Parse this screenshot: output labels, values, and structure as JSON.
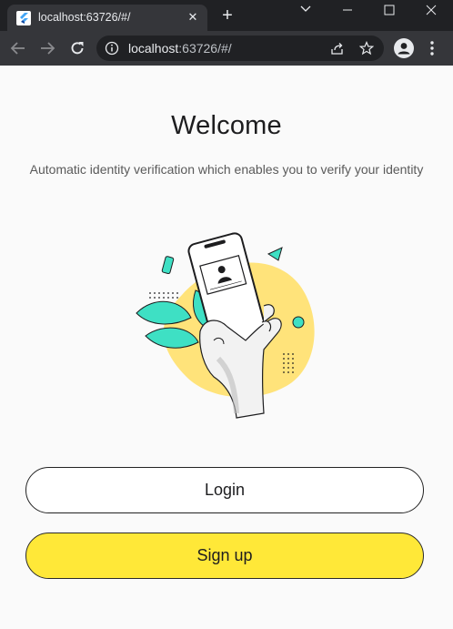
{
  "browser": {
    "tab": {
      "title": "localhost:63726/#/",
      "favicon": "flutter-icon"
    },
    "url": {
      "host": "localhost",
      "rest": ":63726/#/"
    },
    "icons": {
      "back": "arrow-left-icon",
      "forward": "arrow-right-icon",
      "reload": "reload-icon",
      "info": "info-icon",
      "share": "share-icon",
      "bookmark": "star-icon",
      "profile": "profile-icon",
      "menu": "kebab-menu-icon",
      "new_tab": "plus-icon",
      "close_tab": "close-icon",
      "window_minimize": "minimize-icon",
      "window_maximize": "maximize-icon",
      "window_close": "close-icon",
      "tab_search": "chevron-down-icon"
    }
  },
  "page": {
    "title": "Welcome",
    "subtitle": "Automatic identity verification which enables you to verify your identity",
    "buttons": {
      "login": "Login",
      "signup": "Sign up"
    }
  },
  "colors": {
    "accent_yellow": "#ffe838",
    "illustration_teal": "#3ee0c4",
    "illustration_blob": "#ffe37a",
    "text_dark": "#1d1d1f"
  }
}
